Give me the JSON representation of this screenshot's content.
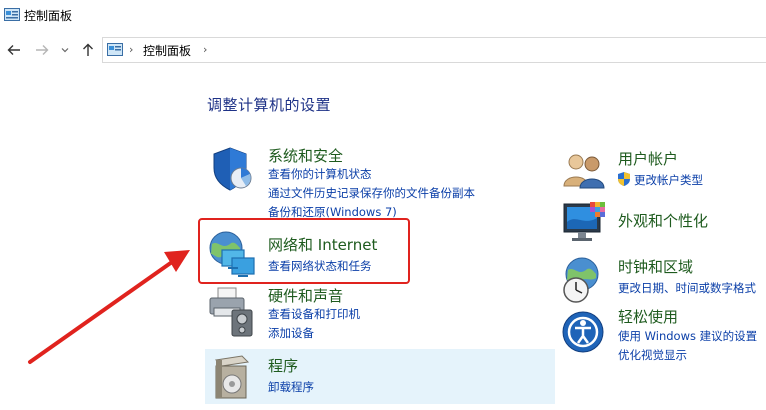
{
  "window": {
    "title": "控制面板"
  },
  "nav": {
    "back_icon": "arrow-left-icon",
    "forward_icon": "arrow-right-icon",
    "recent_icon": "chevron-down-icon",
    "up_icon": "arrow-up-icon"
  },
  "address": {
    "breadcrumb": "控制面板",
    "separator": "›"
  },
  "heading": "调整计算机的设置",
  "categories": {
    "system_security": {
      "title": "系统和安全",
      "links": [
        "查看你的计算机状态",
        "通过文件历史记录保存你的文件备份副本",
        "备份和还原(Windows 7)"
      ]
    },
    "network": {
      "title": "网络和 Internet",
      "links": [
        "查看网络状态和任务"
      ]
    },
    "hardware": {
      "title": "硬件和声音",
      "links": [
        "查看设备和打印机",
        "添加设备"
      ]
    },
    "programs": {
      "title": "程序",
      "links": [
        "卸载程序"
      ]
    },
    "user_accounts": {
      "title": "用户帐户",
      "links": [
        "更改帐户类型"
      ]
    },
    "appearance": {
      "title": "外观和个性化",
      "links": []
    },
    "clock_region": {
      "title": "时钟和区域",
      "links": [
        "更改日期、时间或数字格式"
      ]
    },
    "ease_of_access": {
      "title": "轻松使用",
      "links": [
        "使用 Windows 建议的设置",
        "优化视觉显示"
      ]
    }
  },
  "colors": {
    "highlight_border": "#e0231e",
    "annotation_arrow": "#e0231e",
    "category_title": "#1e5b1e",
    "link": "#0b3fa8",
    "heading": "#1e3287",
    "hover_bg": "#e5f3fb"
  }
}
